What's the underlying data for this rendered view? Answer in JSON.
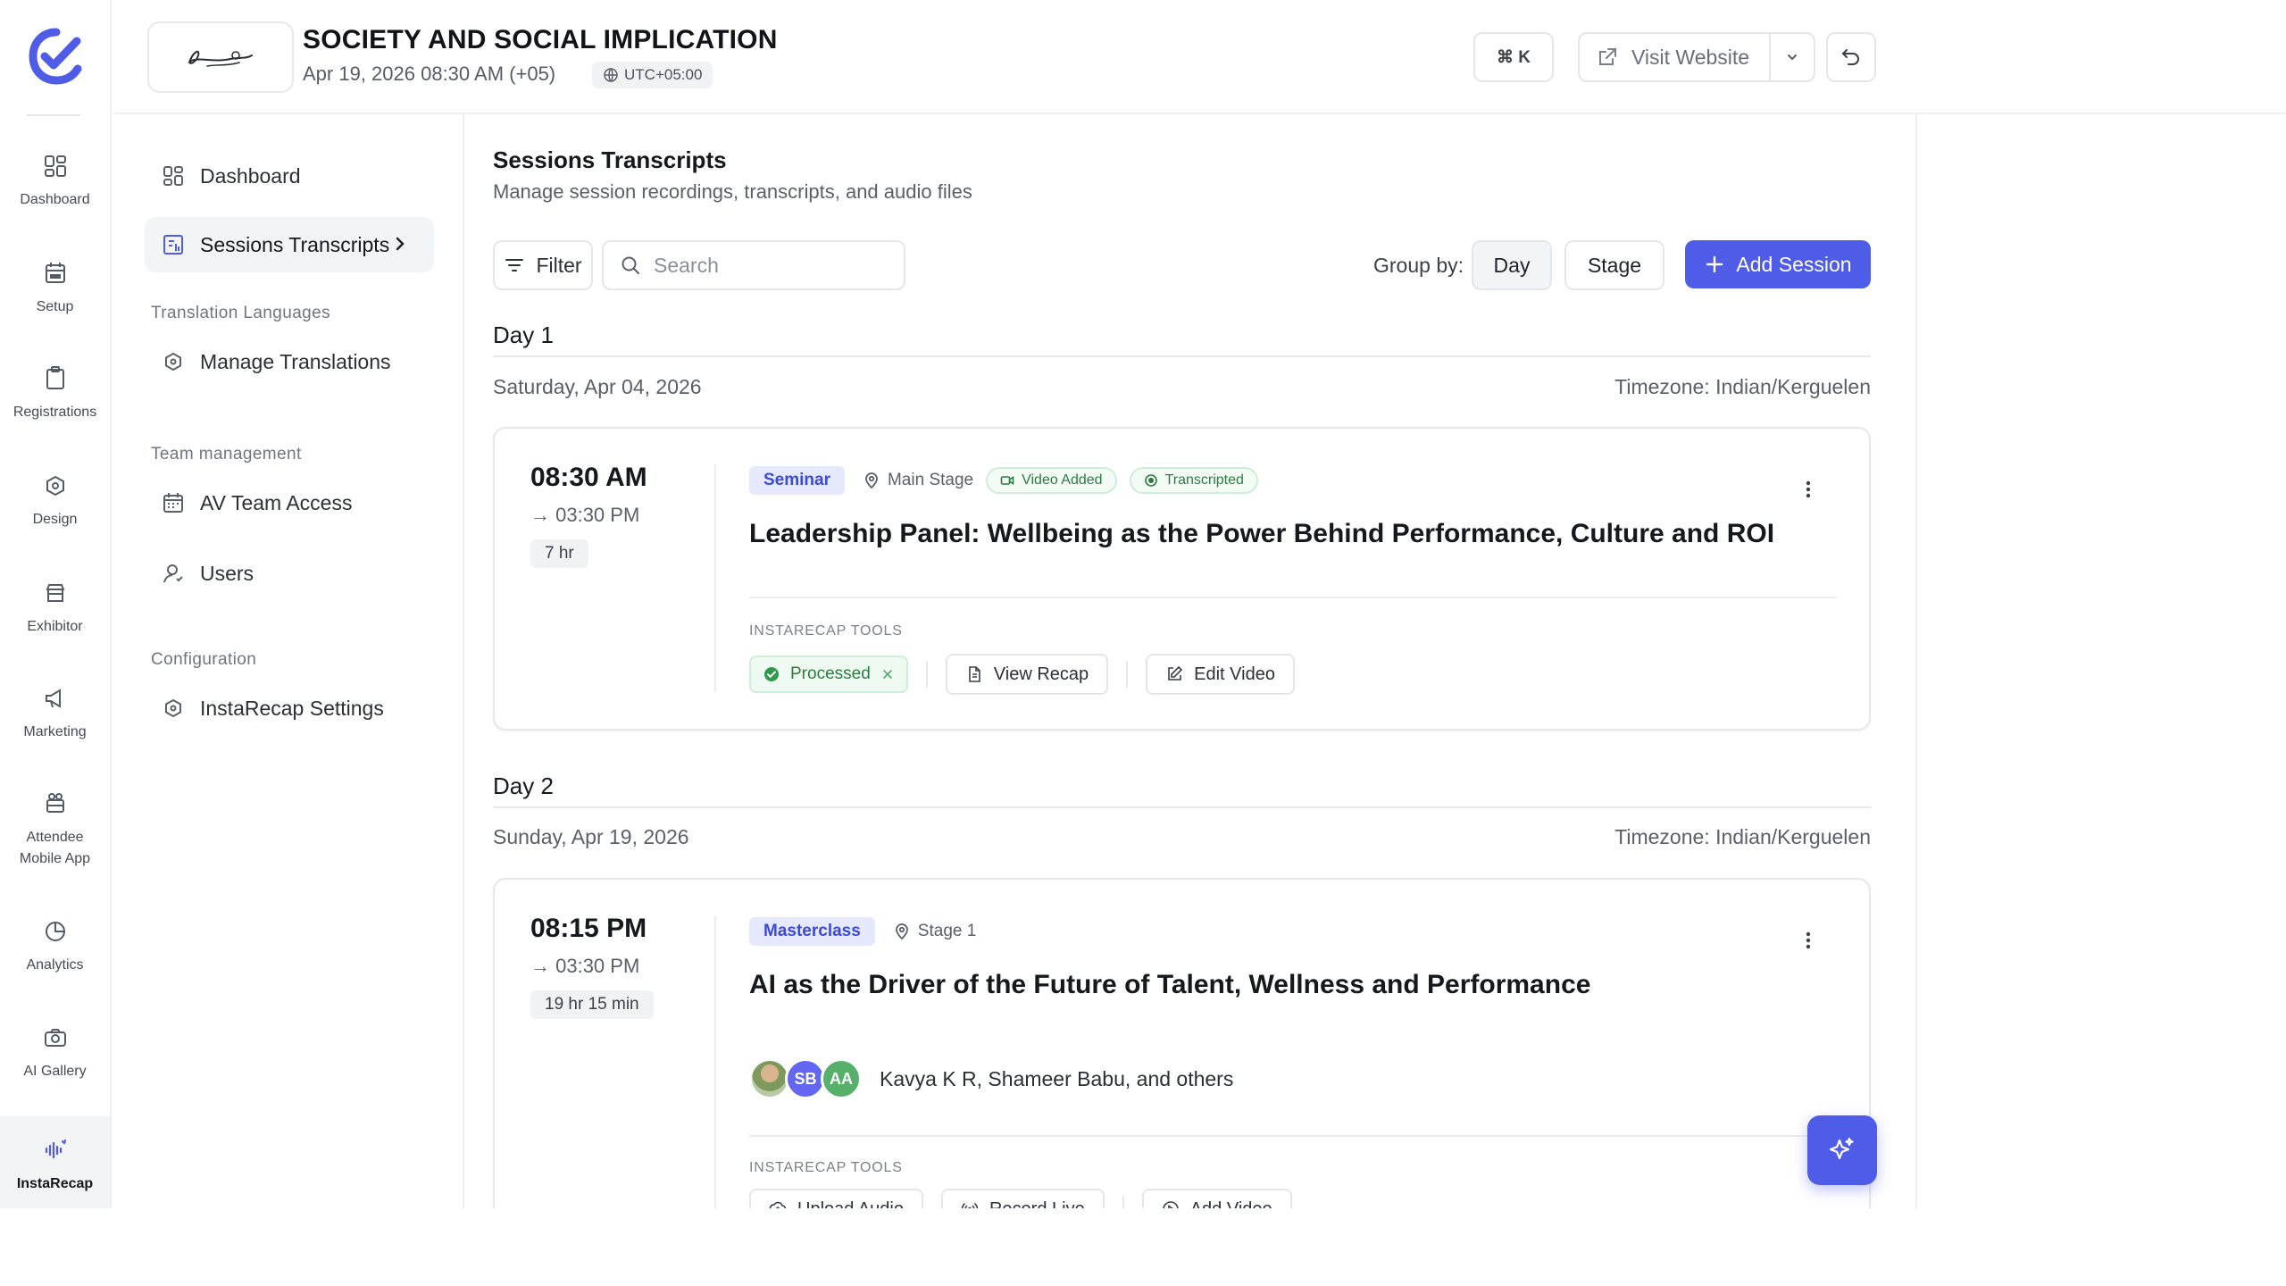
{
  "rail": {
    "items": [
      {
        "label": "Dashboard",
        "icon": "grid-icon"
      },
      {
        "label": "Setup",
        "icon": "calendar-icon"
      },
      {
        "label": "Registrations",
        "icon": "clipboard-icon"
      },
      {
        "label": "Design",
        "icon": "palette-icon"
      },
      {
        "label": "Exhibitor",
        "icon": "store-icon"
      },
      {
        "label": "Marketing",
        "icon": "megaphone-icon"
      },
      {
        "label": "Attendee Mobile App",
        "icon": "mobile-app-icon"
      },
      {
        "label": "Analytics",
        "icon": "pie-chart-icon"
      },
      {
        "label": "AI Gallery",
        "icon": "camera-icon"
      },
      {
        "label": "InstaRecap",
        "icon": "audio-wave-icon"
      }
    ],
    "active": "InstaRecap"
  },
  "header": {
    "event_title": "SOCIETY AND SOCIAL IMPLICATION",
    "event_date": "Apr 19, 2026 08:30 AM (+05)",
    "timezone": "UTC+05:00",
    "kbd_shortcut": "⌘ K",
    "visit_label": "Visit Website"
  },
  "subnav": {
    "dashboard": "Dashboard",
    "sessions": "Sessions Transcripts",
    "group_translation": "Translation Languages",
    "manage_translations": "Manage Translations",
    "group_team": "Team management",
    "av_team": "AV Team Access",
    "users": "Users",
    "group_config": "Configuration",
    "instarecap_settings": "InstaRecap Settings"
  },
  "main": {
    "title": "Sessions Transcripts",
    "subtitle": "Manage session recordings, transcripts, and audio files",
    "filter_label": "Filter",
    "search_placeholder": "Search",
    "group_by_label": "Group by:",
    "group_day": "Day",
    "group_stage": "Stage",
    "add_session": "Add Session",
    "tools_label": "INSTARECAP TOOLS"
  },
  "days": [
    {
      "heading": "Day 1",
      "date": "Saturday, Apr 04, 2026",
      "timezone": "Timezone: Indian/Kerguelen",
      "session": {
        "start": "08:30 AM",
        "end": "→ 03:30 PM",
        "duration": "7 hr",
        "type": "Seminar",
        "stage": "Main Stage",
        "badge_video": "Video Added",
        "badge_transcript": "Transcripted",
        "title": "Leadership Panel: Wellbeing as the Power Behind Performance, Culture and ROI",
        "processed": "Processed",
        "view_recap": "View Recap",
        "edit_video": "Edit Video"
      }
    },
    {
      "heading": "Day 2",
      "date": "Sunday, Apr 19, 2026",
      "timezone": "Timezone: Indian/Kerguelen",
      "session": {
        "start": "08:15 PM",
        "end": "→ 03:30 PM",
        "duration": "19 hr 15 min",
        "type": "Masterclass",
        "stage": "Stage 1",
        "title": "AI as the Driver of the Future of Talent, Wellness and Performance",
        "avatars": [
          "SB",
          "AA"
        ],
        "speakers": "Kavya K R, Shameer Babu, and others",
        "upload_audio": "Upload Audio",
        "record_live": "Record Live",
        "add_video": "Add Video"
      }
    }
  ],
  "colors": {
    "accent": "#4f5ce8",
    "success": "#2e7a43",
    "badge_bg": "#e6e8fd"
  }
}
